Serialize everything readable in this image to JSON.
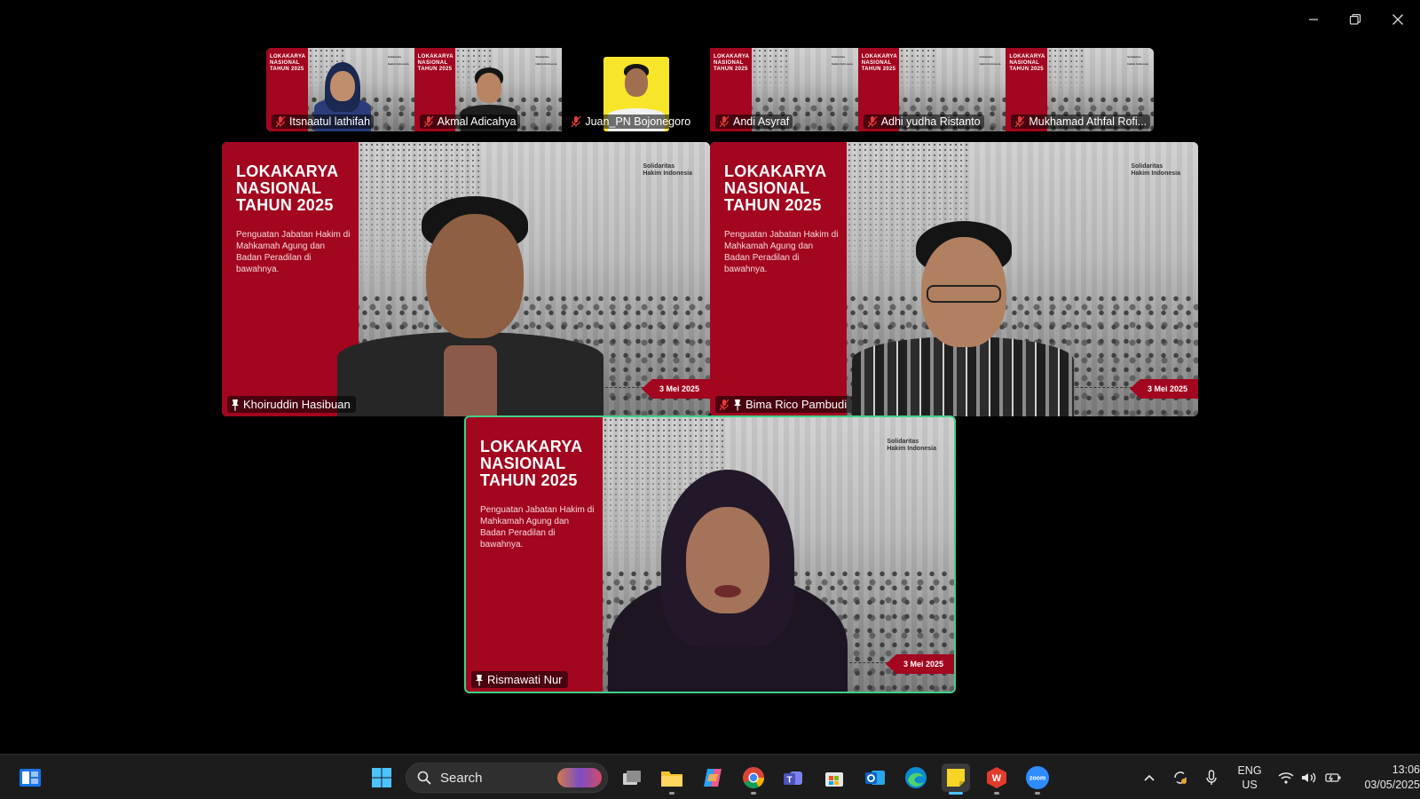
{
  "window": {
    "controls": {
      "minimize_icon": "minimize-icon",
      "restore_icon": "restore-icon",
      "close_icon": "close-icon"
    }
  },
  "slide": {
    "title_line1": "LOKAKARYA",
    "title_line2": "NASIONAL",
    "title_line3": "TAHUN 2025",
    "subtitle": "Penguatan Jabatan Hakim di Mahkamah Agung dan Badan Peradilan di bawahnya.",
    "brand_line1": "Solidaritas",
    "brand_line2": "Hakim Indonesia",
    "date": "3 Mei 2025",
    "colors": {
      "red": "#a3061f"
    }
  },
  "strip": {
    "participants": [
      {
        "name": "Itsnaatul lathifah",
        "muted": true
      },
      {
        "name": "Akmal Adicahya",
        "muted": true
      },
      {
        "name": "Juan_PN Bojonegoro",
        "muted": true
      },
      {
        "name": "Andi Asyraf",
        "muted": true
      },
      {
        "name": "Adhi yudha Ristanto",
        "muted": true
      },
      {
        "name": "Mukhamad Athfal Rofi...",
        "muted": true
      }
    ]
  },
  "main": {
    "tiles": [
      {
        "name": "Khoiruddin Hasibuan",
        "muted": false,
        "pinned": true,
        "speaking": false
      },
      {
        "name": "Bima Rico Pambudi",
        "muted": true,
        "pinned": true,
        "speaking": false
      },
      {
        "name": "Rismawati Nur",
        "muted": false,
        "pinned": true,
        "speaking": true
      }
    ],
    "active_speaker_color": "#3fd28a"
  },
  "taskbar": {
    "search_label": "Search",
    "apps": [
      "widgets-icon",
      "windows-start-icon",
      "task-view-icon",
      "file-explorer-icon",
      "copilot-icon",
      "chrome-icon",
      "teams-icon",
      "microsoft-store-icon",
      "outlook-icon",
      "edge-icon",
      "sticky-notes-icon",
      "wps-office-icon",
      "zoom-icon"
    ],
    "tray": {
      "lang_line1": "ENG",
      "lang_line2": "US",
      "time": "13:06",
      "date": "03/05/2025"
    }
  }
}
